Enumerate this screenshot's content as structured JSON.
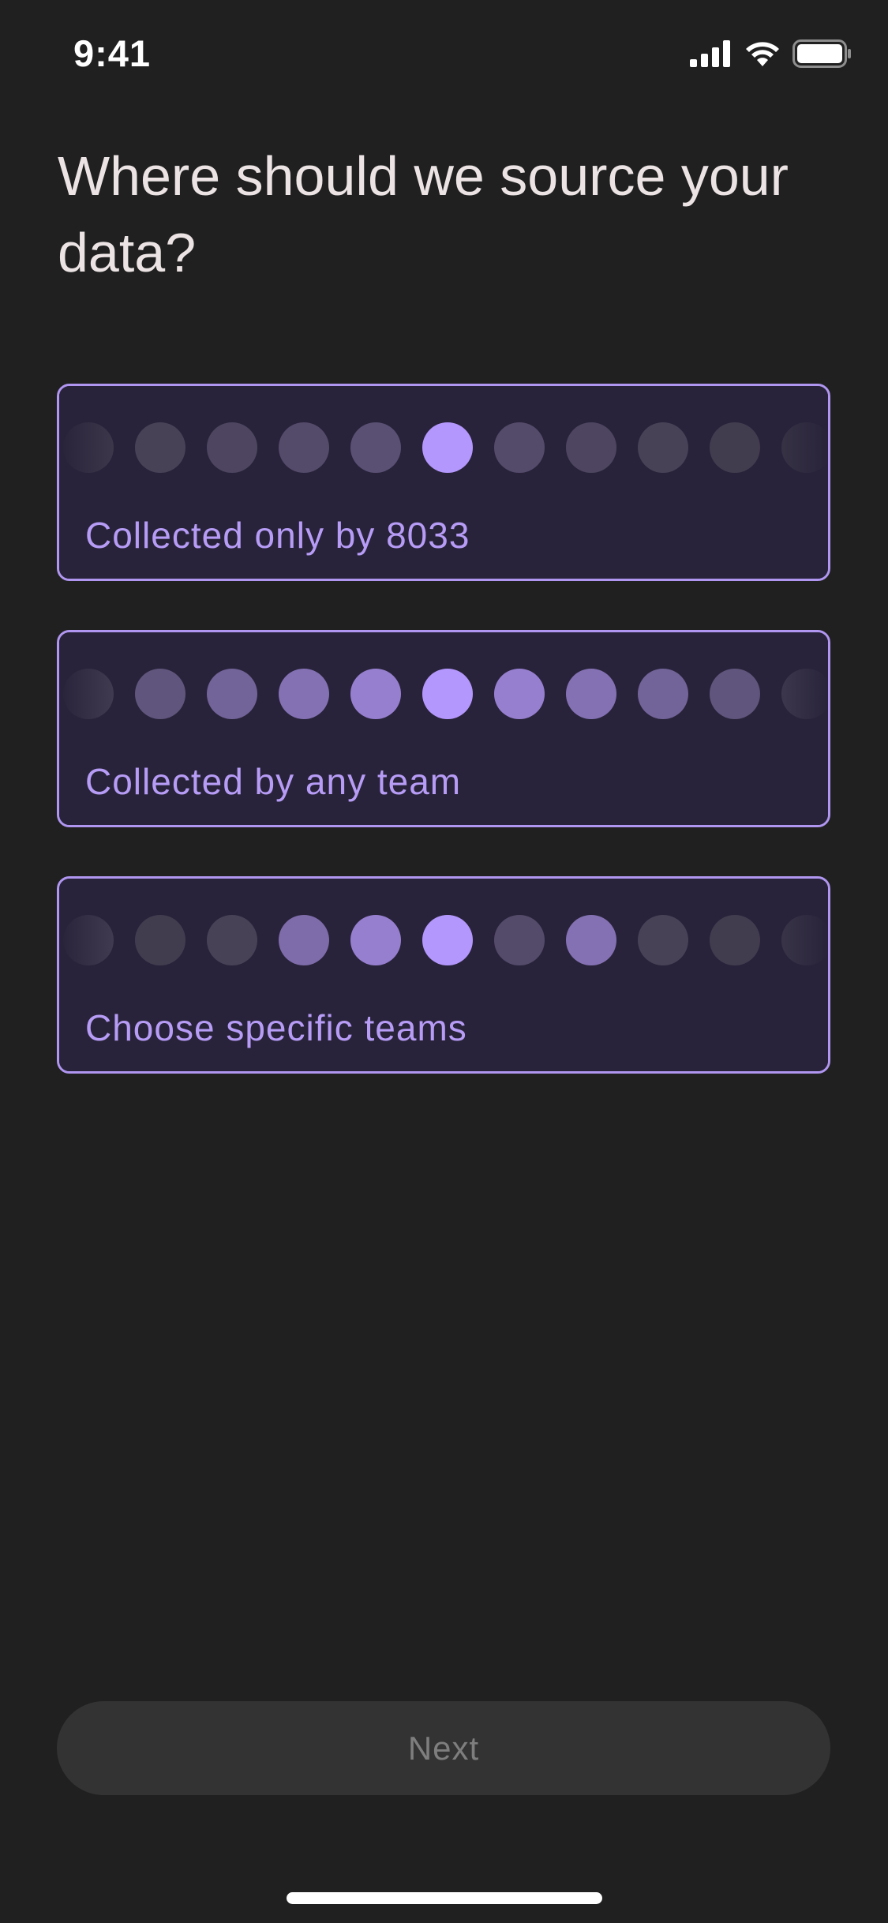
{
  "status_bar": {
    "time": "9:41",
    "icons": [
      "cellular-signal-icon",
      "wifi-icon",
      "battery-icon"
    ]
  },
  "title": "Where should we source your data?",
  "options": [
    {
      "label": "Collected only by 8033",
      "dot_levels": [
        0.05,
        0.1,
        0.15,
        0.2,
        0.25,
        1,
        0.2,
        0.15,
        0.1,
        0.05,
        0.02
      ]
    },
    {
      "label": "Collected by any team",
      "dot_levels": [
        0.1,
        0.3,
        0.45,
        0.6,
        0.75,
        1,
        0.75,
        0.6,
        0.45,
        0.3,
        0.1
      ]
    },
    {
      "label": "Choose specific teams",
      "dot_levels": [
        0.1,
        0.05,
        0.1,
        0.55,
        0.75,
        1,
        0.2,
        0.6,
        0.1,
        0.05,
        0.05
      ]
    }
  ],
  "next_button": {
    "label": "Next",
    "enabled": false
  },
  "colors": {
    "background": "#202020",
    "accent": "#b096f0",
    "card_background": "#28233a",
    "dot_active": "#b497fd",
    "dot_inactive": "#3c3845"
  }
}
